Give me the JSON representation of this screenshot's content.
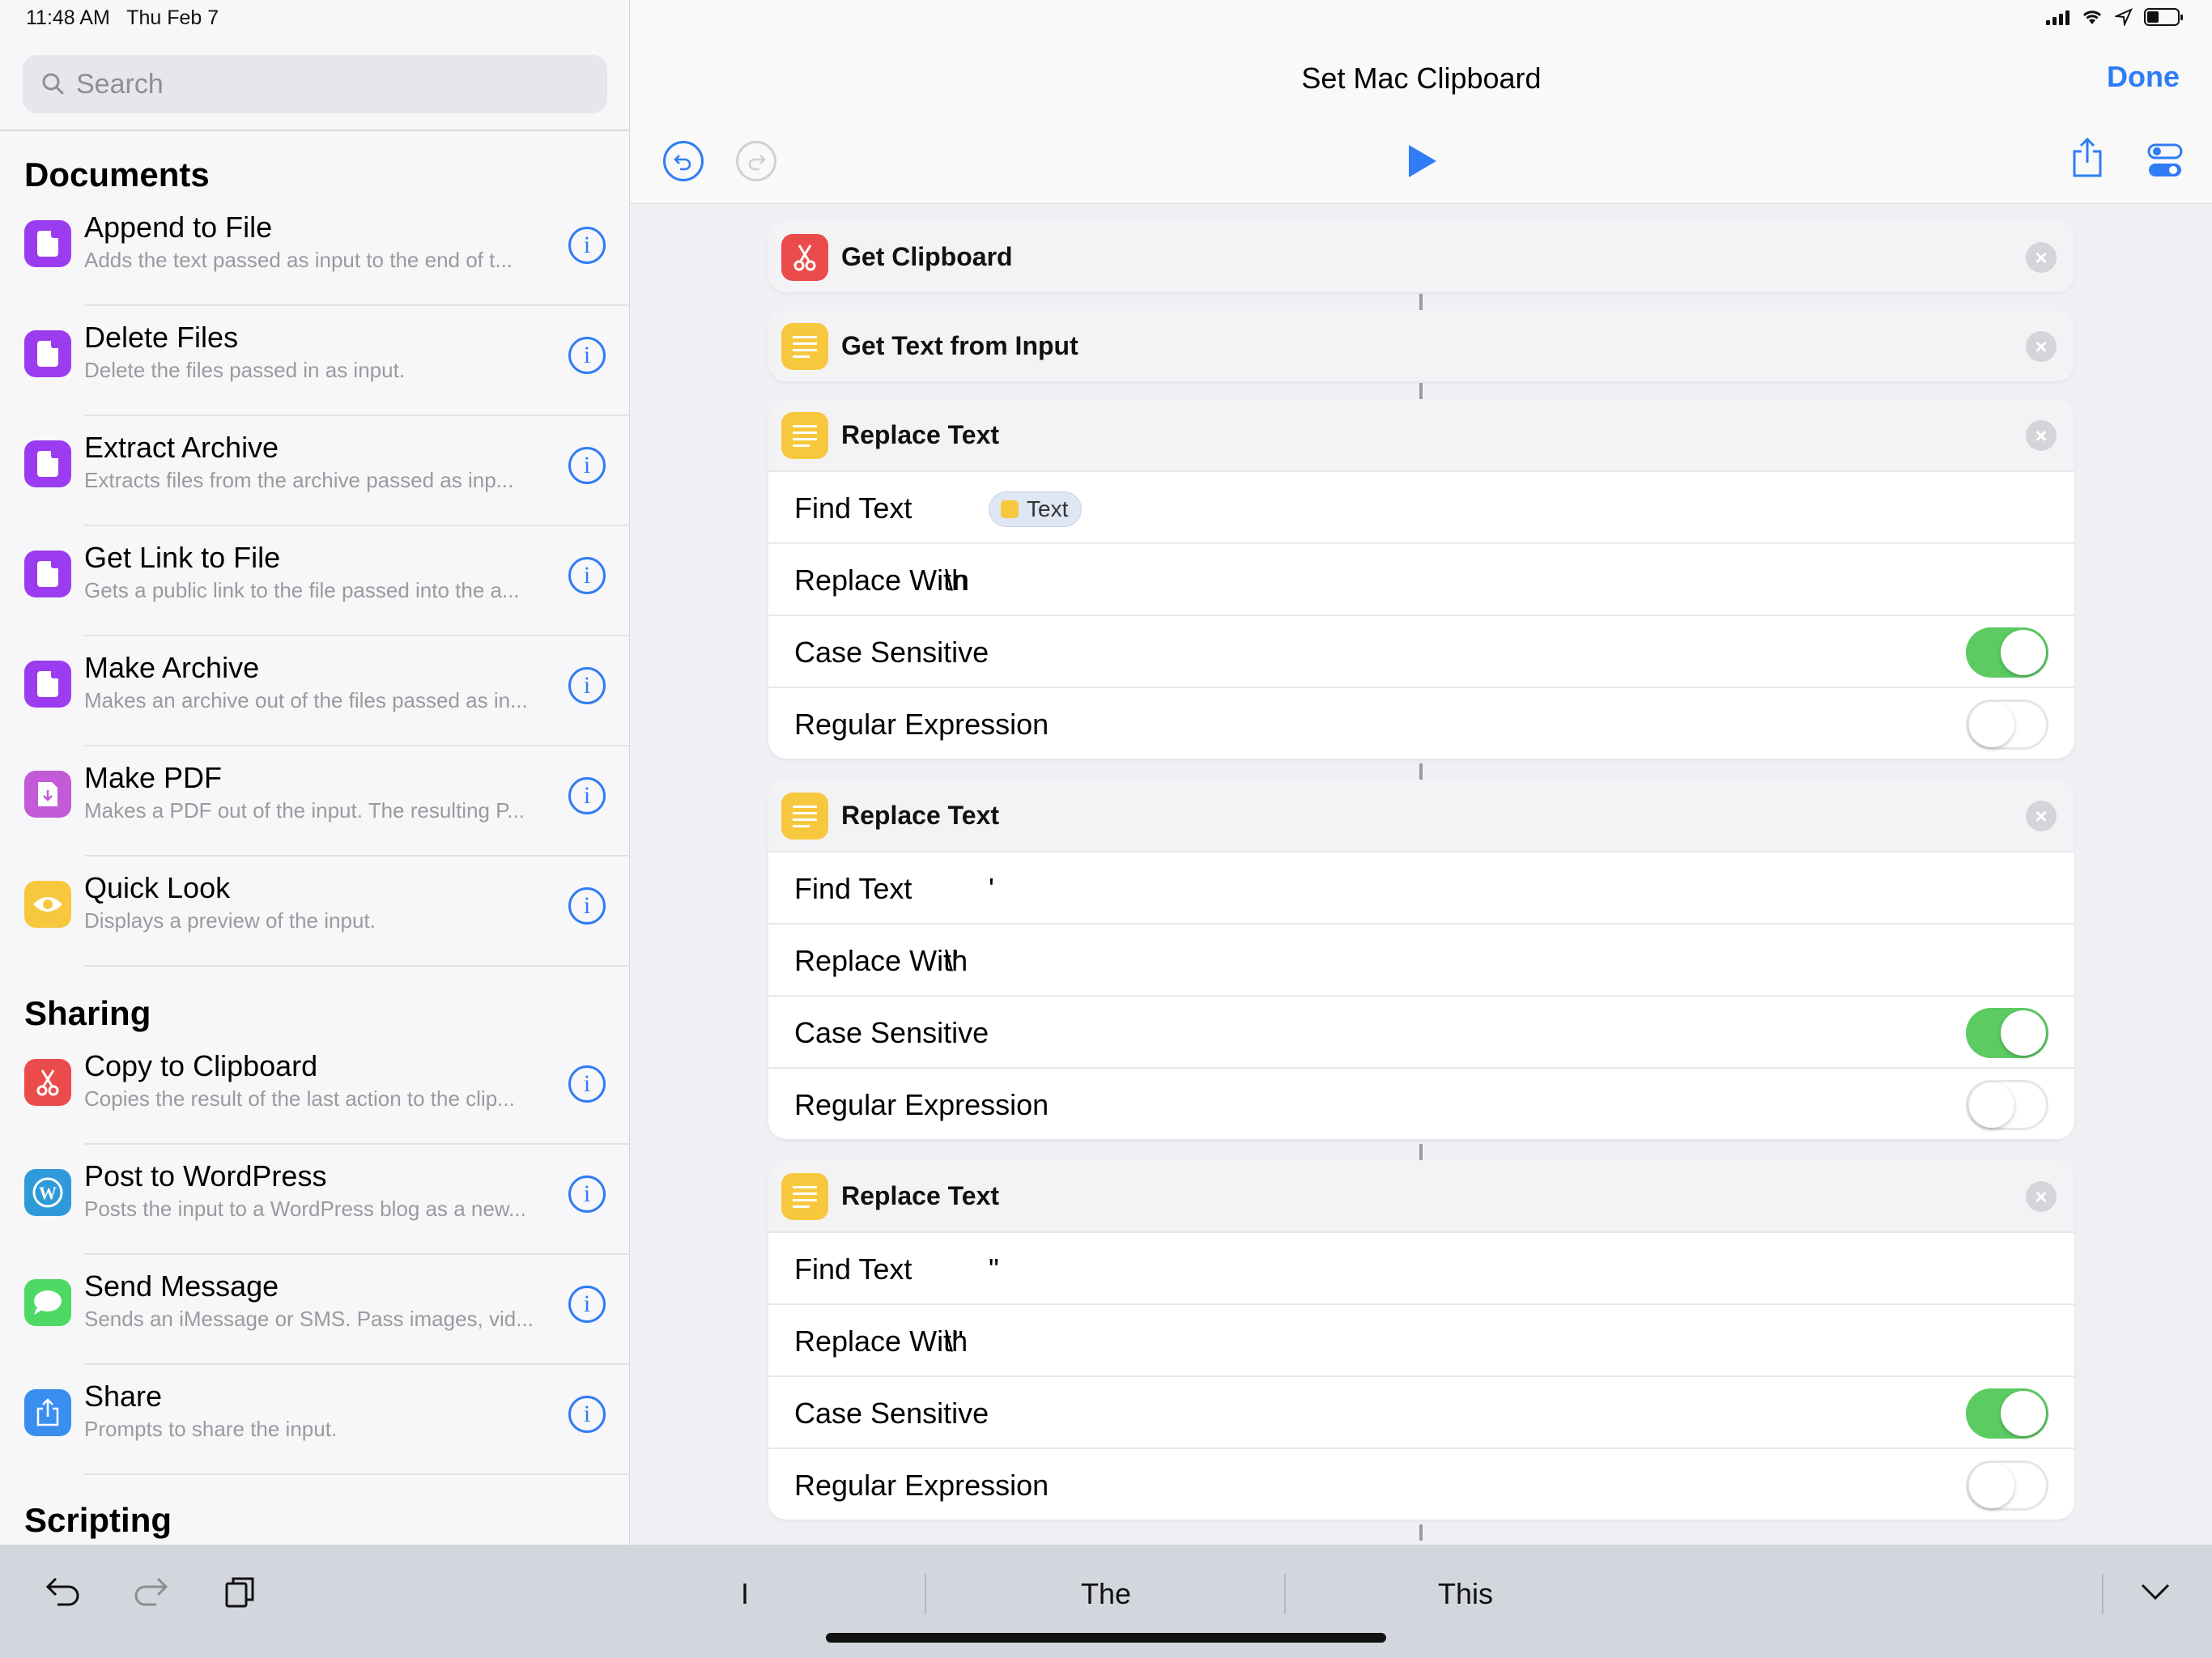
{
  "status": {
    "time": "11:48 AM",
    "date": "Thu Feb 7"
  },
  "sidebar": {
    "search_placeholder": "Search",
    "sections": {
      "documents": "Documents",
      "sharing": "Sharing",
      "scripting": "Scripting"
    },
    "actions": [
      {
        "title": "Append to File",
        "desc": "Adds the text passed as input to the end of t...",
        "icon": "document-icon",
        "color": "#9b3cf0"
      },
      {
        "title": "Delete Files",
        "desc": "Delete the files passed in as input.",
        "icon": "document-icon",
        "color": "#9b3cf0"
      },
      {
        "title": "Extract Archive",
        "desc": "Extracts files from the archive passed as inp...",
        "icon": "document-icon",
        "color": "#9b3cf0"
      },
      {
        "title": "Get Link to File",
        "desc": "Gets a public link to the file passed into the a...",
        "icon": "document-icon",
        "color": "#9b3cf0"
      },
      {
        "title": "Make Archive",
        "desc": "Makes an archive out of the files passed as in...",
        "icon": "document-icon",
        "color": "#9b3cf0"
      },
      {
        "title": "Make PDF",
        "desc": "Makes a PDF out of the input. The resulting P...",
        "icon": "pdf-icon",
        "color": "#c35ad8"
      },
      {
        "title": "Quick Look",
        "desc": "Displays a preview of the input.",
        "icon": "eye-icon",
        "color": "#f7c83e"
      },
      {
        "title": "Copy to Clipboard",
        "desc": "Copies the result of the last action to the clip...",
        "icon": "scissors-icon",
        "color": "#ec4b4b"
      },
      {
        "title": "Post to WordPress",
        "desc": "Posts the input to a WordPress blog as a new...",
        "icon": "wordpress-icon",
        "color": "#2f9ad9"
      },
      {
        "title": "Send Message",
        "desc": "Sends an iMessage or SMS. Pass images, vid...",
        "icon": "message-icon",
        "color": "#4cd964"
      },
      {
        "title": "Share",
        "desc": "Prompts to share the input.",
        "icon": "share-icon",
        "color": "#3a8ef0"
      }
    ]
  },
  "editor": {
    "title": "Set Mac Clipboard",
    "done_label": "Done",
    "labels": {
      "find": "Find Text",
      "replace": "Replace With",
      "case": "Case Sensitive",
      "regex": "Regular Expression"
    },
    "cards": [
      {
        "title": "Get Clipboard",
        "icon": "scissors-icon",
        "color": "#ec4b4b"
      },
      {
        "title": "Get Text from Input",
        "icon": "text-icon",
        "color": "#f7c83e"
      },
      {
        "title": "Replace Text",
        "icon": "text-icon",
        "color": "#f7c83e",
        "find_token": "Text",
        "replace_with": "\\n",
        "case_sensitive": true,
        "regular_expression": false
      },
      {
        "title": "Replace Text",
        "icon": "text-icon",
        "color": "#f7c83e",
        "find_text": "'",
        "replace_with": "\\'",
        "case_sensitive": true,
        "regular_expression": false
      },
      {
        "title": "Replace Text",
        "icon": "text-icon",
        "color": "#f7c83e",
        "find_text": "\"",
        "replace_with": "\\\"",
        "case_sensitive": true,
        "regular_expression": false
      }
    ]
  },
  "keyboard": {
    "suggestions": [
      "I",
      "The",
      "This"
    ]
  },
  "colors": {
    "accent": "#2f7cf6",
    "toggle_on": "#5bcb62"
  }
}
